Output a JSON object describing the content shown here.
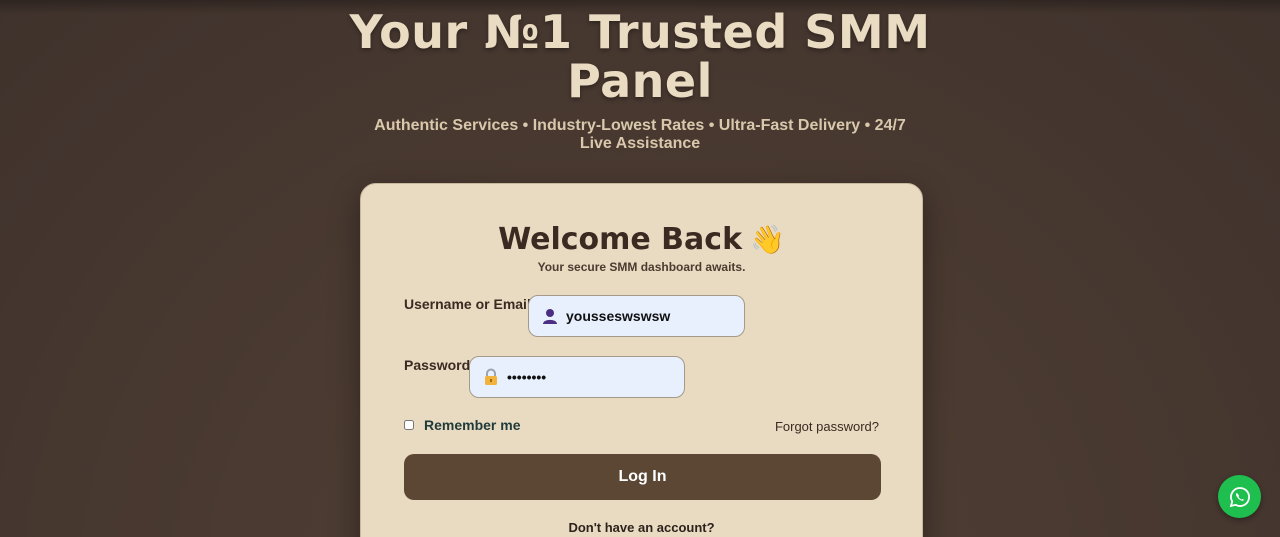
{
  "hero": {
    "title": "Your №1 Trusted SMM Panel",
    "subtitle": "Authentic Services • Industry-Lowest Rates • Ultra-Fast Delivery • 24/7 Live Assistance"
  },
  "login": {
    "title": "Welcome Back",
    "wave_emoji": "👋",
    "subtitle": "Your secure SMM dashboard awaits.",
    "username_label": "Username or Email",
    "username_value": "yousseswswsw",
    "password_label": "Password",
    "password_value": "12345678",
    "remember_label": "Remember me",
    "forgot_label": "Forgot password?",
    "login_button": "Log In",
    "no_account_text": "Don't have an account?"
  },
  "icons": {
    "username": "user-icon",
    "password": "lock-icon",
    "chat": "whatsapp-icon"
  },
  "colors": {
    "background": "#4a3a31",
    "card": "#e8dbc1",
    "button": "#5c4634",
    "hero_text": "#eadcc2",
    "input_bg": "#e8f0fe",
    "whatsapp": "#1fbf4f"
  }
}
